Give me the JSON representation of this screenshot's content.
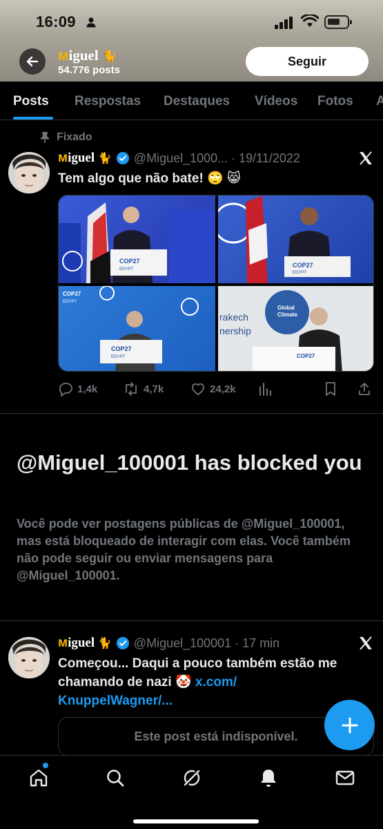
{
  "status_bar": {
    "time": "16:09"
  },
  "header": {
    "name_initial": "ᴍ",
    "name_rest": "iguel",
    "name_emoji": "🐈",
    "post_count": "54.776 posts",
    "follow_label": "Seguir"
  },
  "tabs": [
    {
      "label": "Posts"
    },
    {
      "label": "Respostas"
    },
    {
      "label": "Destaques"
    },
    {
      "label": "Vídeos"
    },
    {
      "label": "Fotos"
    },
    {
      "label": "A"
    }
  ],
  "pinned_post": {
    "pinned_label": "Fixado",
    "name_initial": "ᴍ",
    "name_rest": "iguel",
    "name_emoji": "🐈",
    "handle_date": "@Miguel_1000... · 19/11/2022",
    "text": "Tem algo que não bate! 🙄 😸",
    "stats": {
      "replies": "1,4k",
      "reposts": "4,7k",
      "likes": "24,2k"
    },
    "images": [
      {
        "caption": "COP27 EGYPT"
      },
      {
        "caption": "COP27 EGYPT"
      },
      {
        "caption": "COP27 EGYPT"
      },
      {
        "caption": "rakech nership"
      }
    ]
  },
  "blocked": {
    "title": "@Miguel_100001 has blocked you",
    "description": "Você pode ver postagens públicas de @Miguel_100001, mas está bloqueado de interagir com elas. Você também não pode seguir ou enviar mensagens para @Miguel_100001."
  },
  "second_post": {
    "name_initial": "ᴍ",
    "name_rest": "iguel",
    "name_emoji": "🐈",
    "handle_date": "@Miguel_100001 · 17 min",
    "text_line1": "Começou... Daqui a pouco também estão me",
    "text_line2_prefix": "chamando de nazi 🤡 ",
    "link_part1": "x.com/",
    "link_part2": "KnuppelWagner/...",
    "unavailable_label": "Este post está indisponível."
  },
  "colors": {
    "accent": "#1d9bf0",
    "background": "#000000",
    "muted_text": "#71767b",
    "name_gold": "#f5b400"
  }
}
